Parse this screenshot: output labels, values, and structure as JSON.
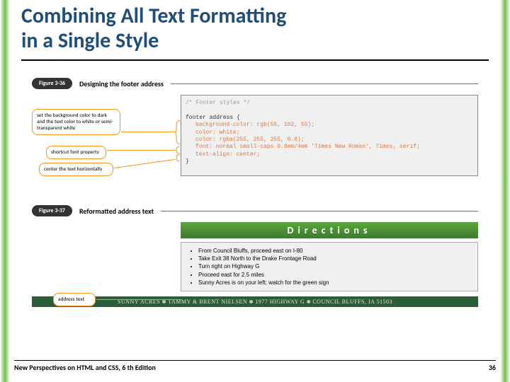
{
  "title_line1": "Combining All Text Formatting",
  "title_line2": "in a Single Style",
  "fig336": {
    "tag": "Figure 3-36",
    "title": "Designing the footer address",
    "callout1": "set the background color to dark and the text color to white or semi-transparent white",
    "callout2": "shortcut font property",
    "callout3": "center the text horizontally",
    "code_comment": "/* Footer styles */",
    "code_sel": "footer address {",
    "code_l1": "background-color: rgb(55, 102, 55);",
    "code_l2": "color: white;",
    "code_l3": "color: rgba(255, 255, 255, 0.8);",
    "code_l4": "font: normal small-caps 0.8em/4em 'Times New Roman', Times, serif;",
    "code_l5": "text-align: center;",
    "code_end": "}"
  },
  "fig337": {
    "tag": "Figure 3-37",
    "title": "Reformatted address text",
    "callout": "address text",
    "directions": "Directions",
    "items": [
      "From Council Bluffs, proceed east on I-80",
      "Take Exit 38 North to the Drake Frontage Road",
      "Turn right on Highway G",
      "Proceed east for 2.5 miles",
      "Sunny Acres is on your left; watch for the green sign"
    ],
    "addr_parts": [
      "SUNNY ACRES",
      "TAMMY & BRENT NIELSEN",
      "1977 HIGHWAY G",
      "COUNCIL BLUFFS, IA   51503"
    ]
  },
  "footer": {
    "left": "New Perspectives on HTML and CSS, 6 th Edition",
    "right": "36"
  }
}
